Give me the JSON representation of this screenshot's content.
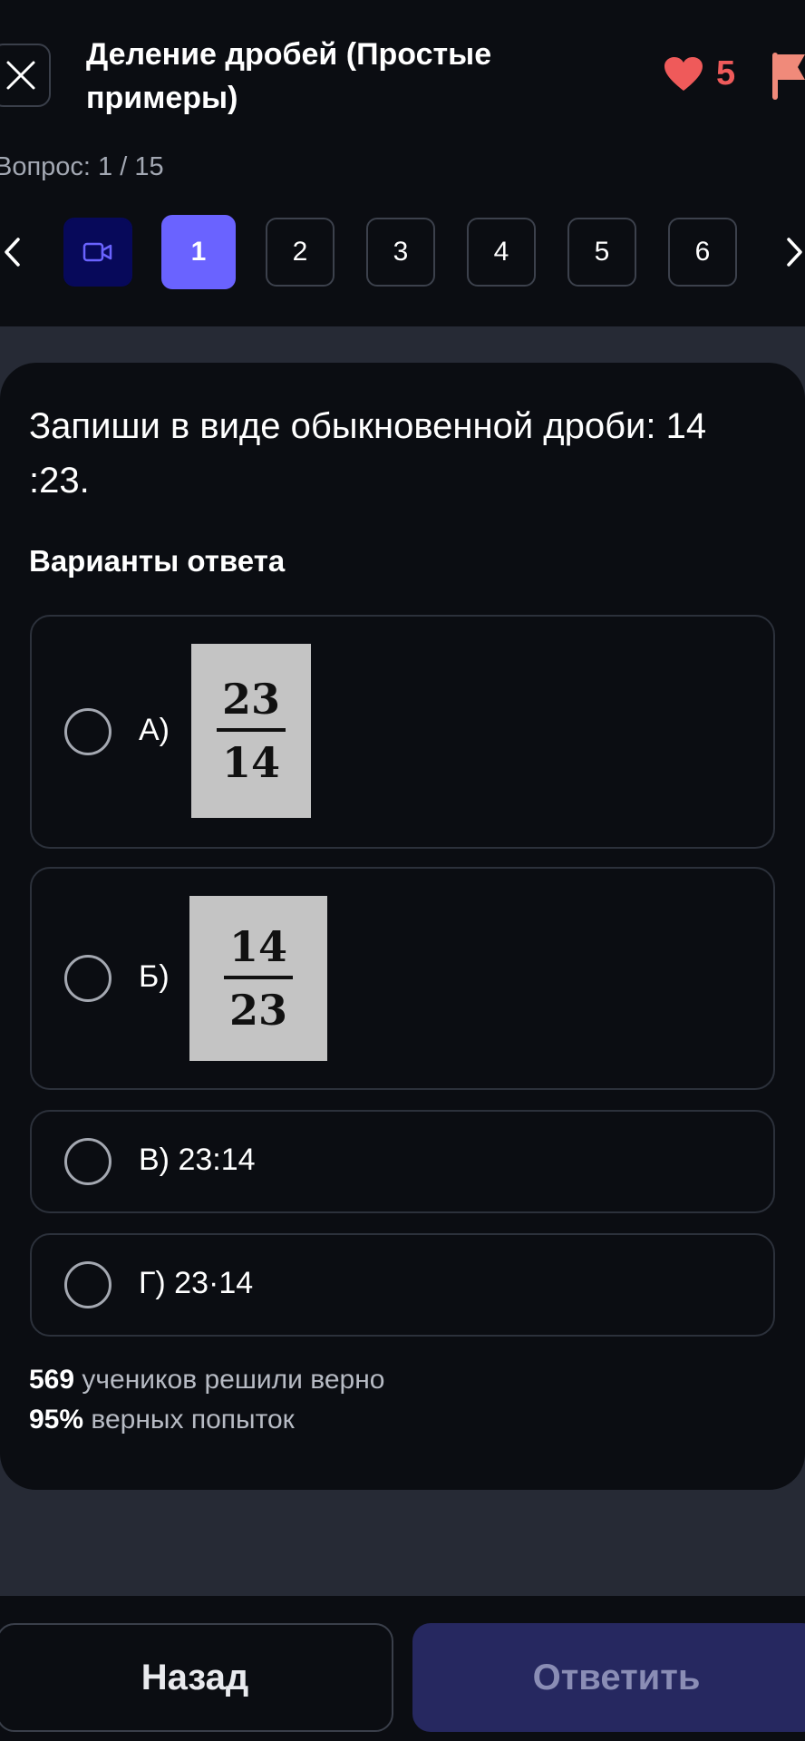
{
  "header": {
    "title": "Деление дробей (Простые примеры)",
    "lives": "5",
    "counter": "Вопрос: 1 / 15"
  },
  "nav": {
    "items": [
      "1",
      "2",
      "3",
      "4",
      "5",
      "6"
    ],
    "active": "1"
  },
  "question": {
    "text": "Запиши в виде обыкновенной дроби: 14 :23.",
    "answers_title": "Варианты ответа",
    "options": [
      {
        "label": "А)",
        "numerator": "23",
        "denominator": "14"
      },
      {
        "label": "Б)",
        "numerator": "14",
        "denominator": "23"
      },
      {
        "label": "В) 23:14"
      },
      {
        "label": "Г) 23·14"
      }
    ]
  },
  "stats": {
    "solved_count": "569",
    "solved_text": "учеников решили верно",
    "percent": "95%",
    "percent_text": "верных попыток"
  },
  "footer": {
    "back_label": "Назад",
    "submit_label": "Ответить"
  },
  "colors": {
    "accent": "#6a63ff",
    "heart": "#ef5a5a",
    "flag": "#f08a7a",
    "video_bg": "#07095a",
    "submit_bg": "#262860"
  }
}
